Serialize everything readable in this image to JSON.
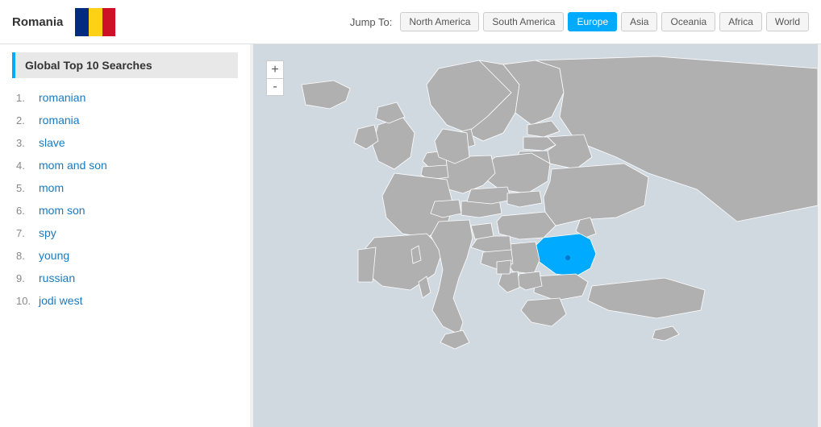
{
  "header": {
    "country_name": "Romania",
    "jump_to_label": "Jump To:",
    "nav_items": [
      {
        "label": "North America",
        "active": false
      },
      {
        "label": "South America",
        "active": false
      },
      {
        "label": "Europe",
        "active": true
      },
      {
        "label": "Asia",
        "active": false
      },
      {
        "label": "Oceania",
        "active": false
      },
      {
        "label": "Africa",
        "active": false
      },
      {
        "label": "World",
        "active": false
      }
    ]
  },
  "sidebar": {
    "title": "Global Top 10 Searches",
    "searches": [
      {
        "rank": "1.",
        "term": "romanian"
      },
      {
        "rank": "2.",
        "term": "romania"
      },
      {
        "rank": "3.",
        "term": "slave"
      },
      {
        "rank": "4.",
        "term": "mom and son"
      },
      {
        "rank": "5.",
        "term": "mom"
      },
      {
        "rank": "6.",
        "term": "mom son"
      },
      {
        "rank": "7.",
        "term": "spy"
      },
      {
        "rank": "8.",
        "term": "young"
      },
      {
        "rank": "9.",
        "term": "russian"
      },
      {
        "rank": "10.",
        "term": "jodi west"
      }
    ]
  },
  "map": {
    "zoom_in_label": "+",
    "zoom_out_label": "-"
  }
}
